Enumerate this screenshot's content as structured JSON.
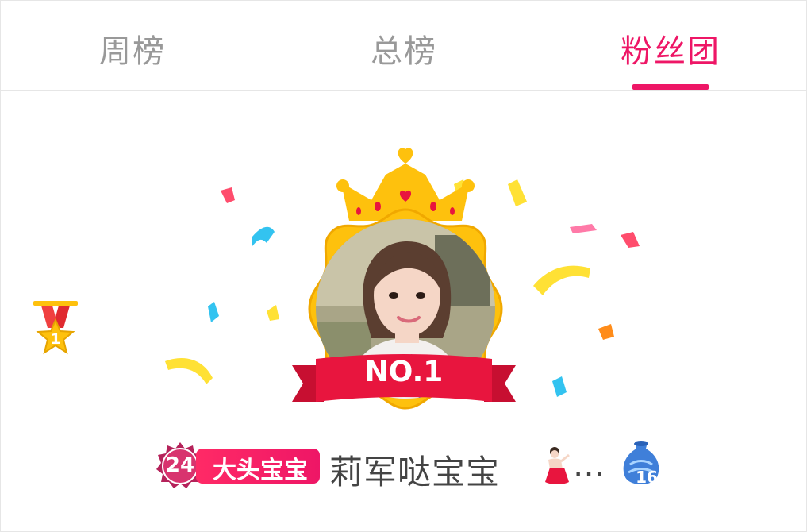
{
  "tabs": [
    {
      "label": "周榜",
      "active": false
    },
    {
      "label": "总榜",
      "active": false
    },
    {
      "label": "粉丝团",
      "active": true
    }
  ],
  "colors": {
    "accent": "#ee1666",
    "tab_inactive": "#999999",
    "gold": "#fec10d",
    "ribbon": "#e8153e",
    "text": "#444444"
  },
  "rank_medal": {
    "number": "1",
    "icon": "gold-star-medal-icon"
  },
  "top_fan": {
    "badge_label": "NO.1",
    "crown_icon": "crown-icon",
    "level": "24",
    "club_name": "大头宝宝",
    "username": "莉军哒宝宝",
    "name_suffix_emoji": "dancing-woman-emoji",
    "ellipsis": "...",
    "gift_level": "16",
    "gift_icon": "blue-vase-icon"
  }
}
